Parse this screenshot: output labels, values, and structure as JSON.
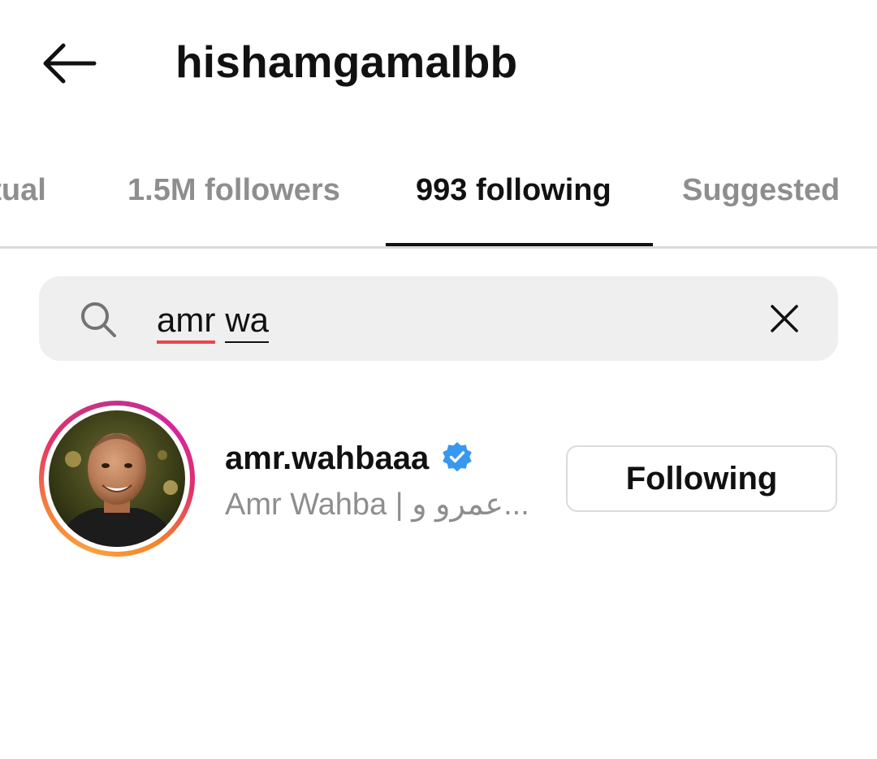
{
  "header": {
    "title": "hishamgamalbb",
    "back_icon": "arrow-left-icon"
  },
  "tabs": [
    {
      "label": "utual",
      "active": false
    },
    {
      "label": "1.5M followers",
      "active": false
    },
    {
      "label": "993 following",
      "active": true
    },
    {
      "label": "Suggested",
      "active": false
    }
  ],
  "search": {
    "icon": "search-icon",
    "query_word_1": "amr",
    "query_word_2": "wa",
    "clear_icon": "close-icon"
  },
  "results": [
    {
      "username": "amr.wahbaaa",
      "verified": true,
      "subtitle": "Amr Wahba | عمرو و...",
      "button_label": "Following",
      "has_story_ring": true
    }
  ],
  "colors": {
    "verified_blue": "#3897f0",
    "muted_text": "#8e8e8e",
    "search_bg": "#efefef",
    "spellcheck_underline": "#e5484d"
  }
}
